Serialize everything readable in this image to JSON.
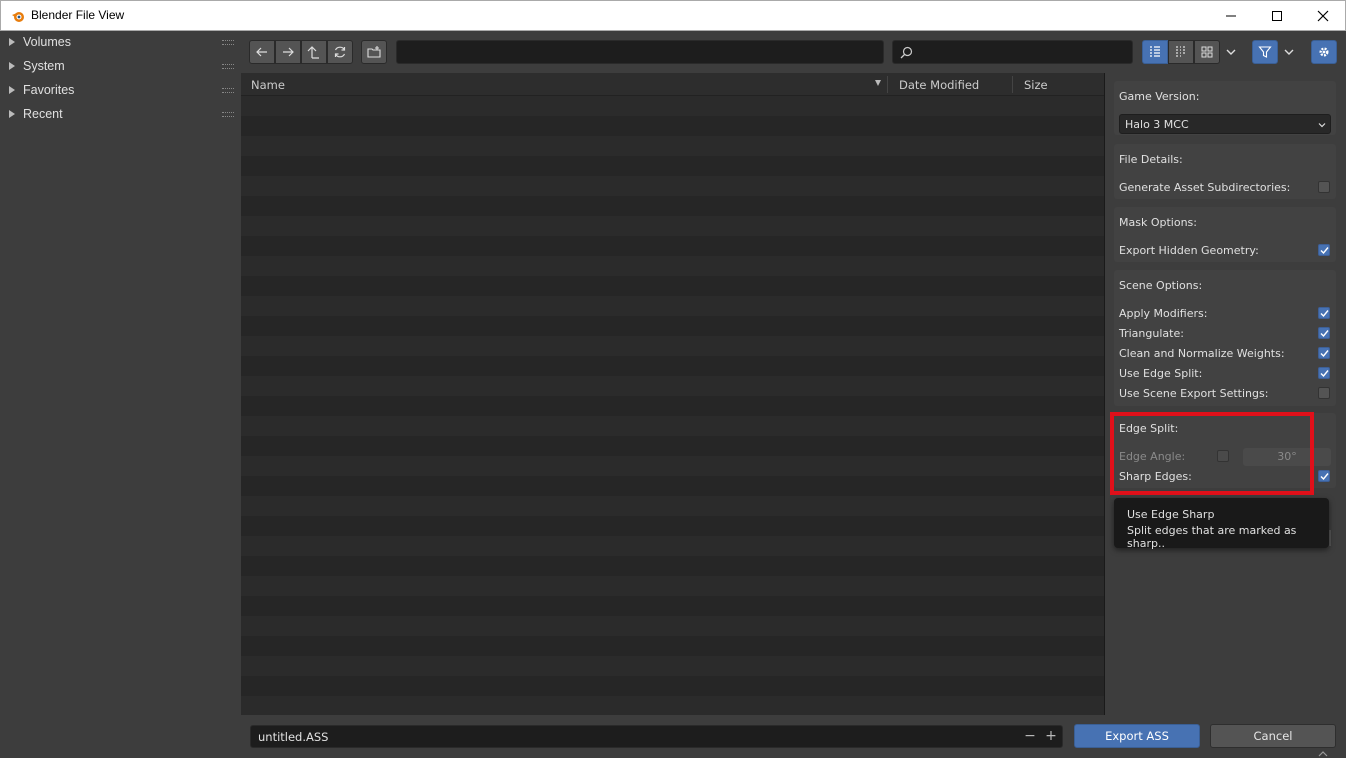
{
  "window": {
    "title": "Blender File View"
  },
  "sidebar": {
    "items": [
      {
        "label": "Volumes"
      },
      {
        "label": "System"
      },
      {
        "label": "Favorites"
      },
      {
        "label": "Recent"
      }
    ]
  },
  "toolbar": {
    "path_value": "",
    "search_value": ""
  },
  "file_list": {
    "columns": [
      "Name",
      "Date Modified",
      "Size"
    ]
  },
  "options": {
    "game_version": {
      "label": "Game Version:",
      "value": "Halo 3 MCC"
    },
    "file_details": {
      "heading": "File Details:",
      "generate_subdirs": {
        "label": "Generate Asset Subdirectories:",
        "checked": false
      }
    },
    "mask_options": {
      "heading": "Mask Options:",
      "export_hidden": {
        "label": "Export Hidden Geometry:",
        "checked": true
      }
    },
    "scene_options": {
      "heading": "Scene Options:",
      "apply_modifiers": {
        "label": "Apply Modifiers:",
        "checked": true
      },
      "triangulate": {
        "label": "Triangulate:",
        "checked": true
      },
      "clean_weights": {
        "label": "Clean and Normalize Weights:",
        "checked": true
      },
      "use_edge_split": {
        "label": "Use Edge Split:",
        "checked": true
      },
      "use_scene_export": {
        "label": "Use Scene Export Settings:",
        "checked": false
      }
    },
    "edge_split": {
      "heading": "Edge Split:",
      "edge_angle": {
        "label": "Edge Angle:",
        "checked": false,
        "value": "30°"
      },
      "sharp_edges": {
        "label": "Sharp Edges:",
        "checked": true
      }
    }
  },
  "tooltip": {
    "title": "Use Edge Sharp",
    "description": "Split edges that are marked as sharp.."
  },
  "bottom": {
    "filename": "untitled.ASS",
    "export_label": "Export ASS",
    "cancel_label": "Cancel"
  },
  "colors": {
    "accent": "#4772b3",
    "highlight_box": "#e0101a"
  }
}
